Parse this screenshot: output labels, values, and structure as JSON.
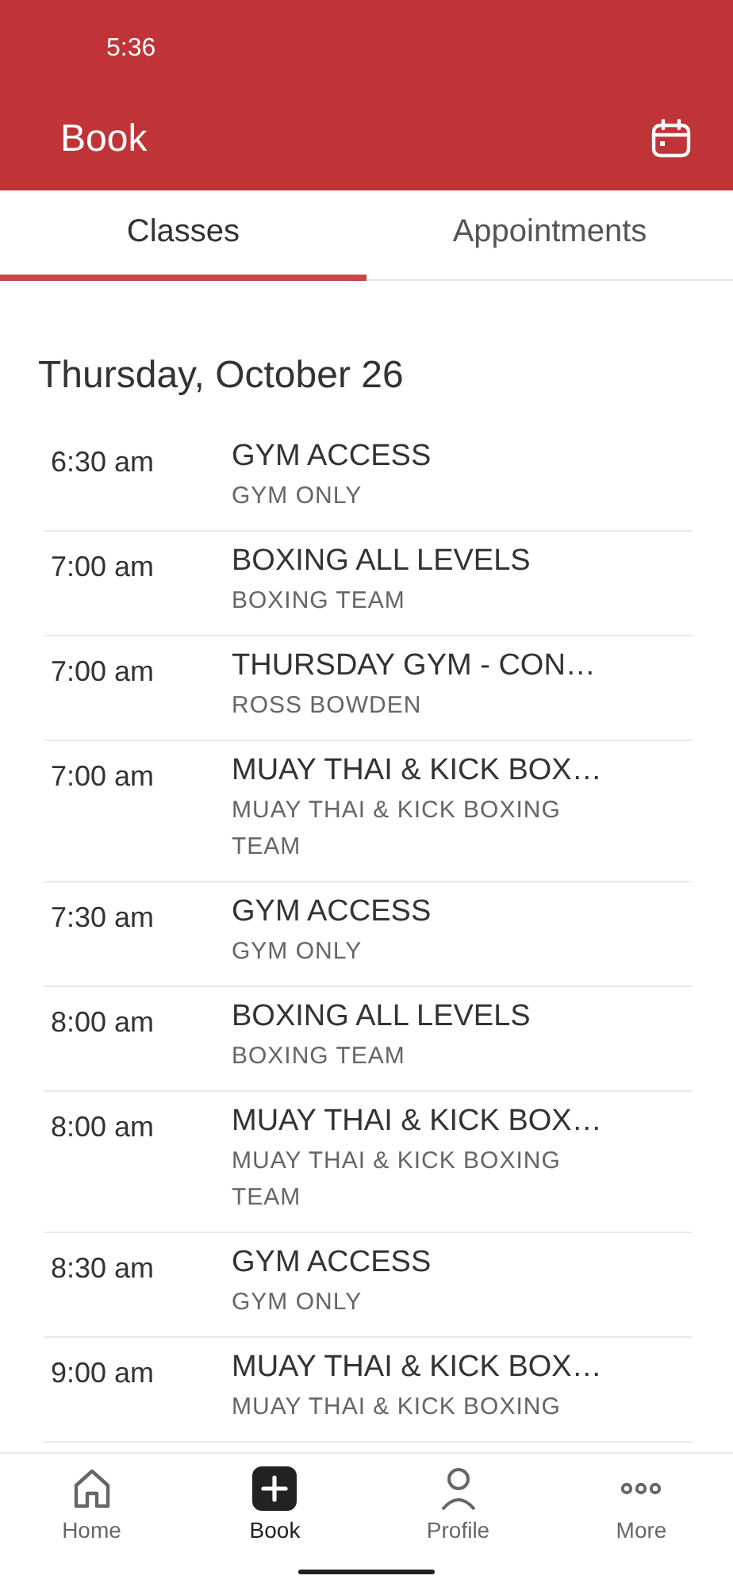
{
  "status_bar": {
    "time": "5:36"
  },
  "header": {
    "title": "Book"
  },
  "tabs": [
    {
      "label": "Classes",
      "selected": true
    },
    {
      "label": "Appointments",
      "selected": false
    }
  ],
  "date_heading": "Thursday, October 26",
  "classes": [
    {
      "time": "6:30 am",
      "title": "GYM ACCESS",
      "subtitle": "GYM ONLY"
    },
    {
      "time": "7:00 am",
      "title": "BOXING ALL LEVELS",
      "subtitle": "BOXING TEAM"
    },
    {
      "time": "7:00 am",
      "title": "THURSDAY GYM - CON…",
      "subtitle": "ROSS BOWDEN"
    },
    {
      "time": "7:00 am",
      "title": "MUAY THAI & KICK BOX…",
      "subtitle": "MUAY THAI & KICK BOXING TEAM"
    },
    {
      "time": "7:30 am",
      "title": "GYM ACCESS",
      "subtitle": "GYM ONLY"
    },
    {
      "time": "8:00 am",
      "title": "BOXING ALL LEVELS",
      "subtitle": "BOXING TEAM"
    },
    {
      "time": "8:00 am",
      "title": "MUAY THAI & KICK BOX…",
      "subtitle": "MUAY THAI & KICK BOXING TEAM"
    },
    {
      "time": "8:30 am",
      "title": "GYM ACCESS",
      "subtitle": "GYM ONLY"
    },
    {
      "time": "9:00 am",
      "title": "MUAY THAI & KICK BOX…",
      "subtitle": "MUAY THAI & KICK BOXING"
    }
  ],
  "bottom_nav": [
    {
      "kind": "home",
      "label": "Home",
      "selected": false
    },
    {
      "kind": "book",
      "label": "Book",
      "selected": true
    },
    {
      "kind": "profile",
      "label": "Profile",
      "selected": false
    },
    {
      "kind": "more",
      "label": "More",
      "selected": false
    }
  ]
}
